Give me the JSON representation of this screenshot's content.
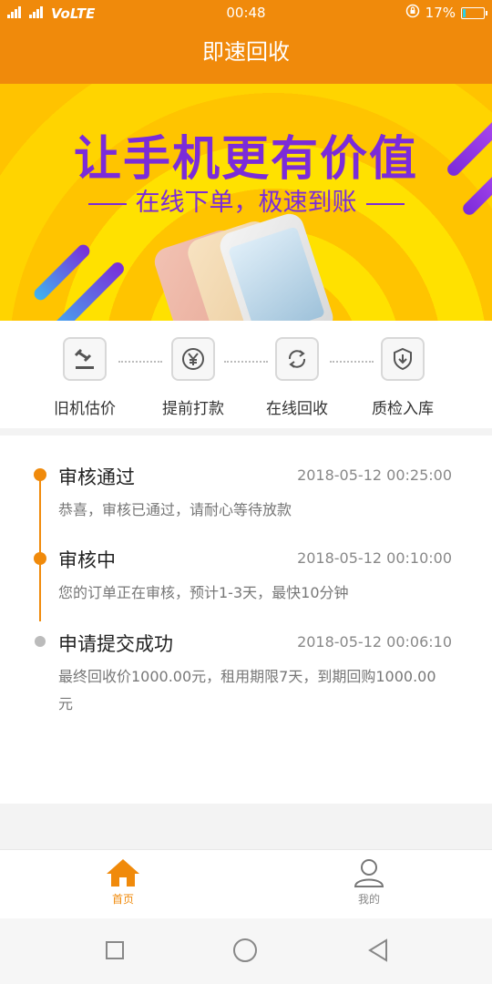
{
  "status_bar": {
    "network": "VoLTE",
    "time": "00:48",
    "battery": "17%",
    "battery_level": 0.17
  },
  "header": {
    "title": "即速回收"
  },
  "banner": {
    "headline": "让手机更有价值",
    "subline": "在线下单，极速到账"
  },
  "steps": [
    {
      "label": "旧机估价",
      "icon": "gavel-icon"
    },
    {
      "label": "提前打款",
      "icon": "yen-icon"
    },
    {
      "label": "在线回收",
      "icon": "refresh-icon"
    },
    {
      "label": "质检入库",
      "icon": "shield-download-icon"
    }
  ],
  "timeline": [
    {
      "title": "审核通过",
      "time": "2018-05-12 00:25:00",
      "desc": "恭喜，审核已通过，请耐心等待放款",
      "state": "active"
    },
    {
      "title": "审核中",
      "time": "2018-05-12 00:10:00",
      "desc": "您的订单正在审核，预计1-3天，最快10分钟",
      "state": "active"
    },
    {
      "title": "申请提交成功",
      "time": "2018-05-12 00:06:10",
      "desc": "最终回收价1000.00元，租用期限7天，到期回购1000.00元",
      "state": "done"
    }
  ],
  "tabs": [
    {
      "label": "首页",
      "icon": "home-icon",
      "selected": true
    },
    {
      "label": "我的",
      "icon": "user-icon",
      "selected": false
    }
  ],
  "colors": {
    "accent": "#f08a0b",
    "banner_text": "#7b2bd9",
    "inactive_dot": "#bbbbbb"
  }
}
